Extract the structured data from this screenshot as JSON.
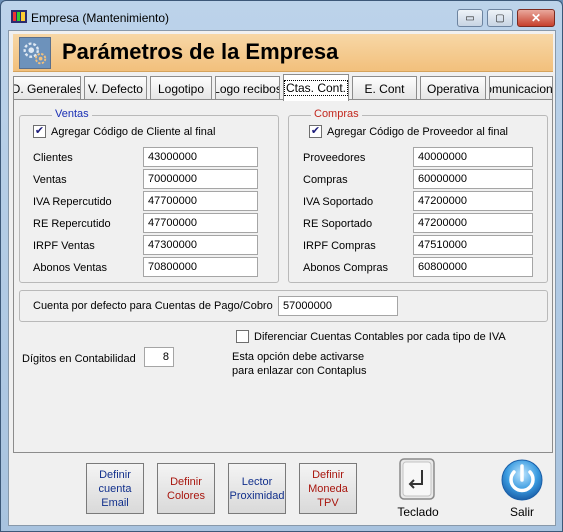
{
  "window": {
    "title": "Empresa  (Mantenimiento)",
    "minimize_glyph": "▭",
    "maximize_glyph": "▢",
    "close_glyph": "✕"
  },
  "banner": {
    "title": "Parámetros de la Empresa"
  },
  "tabs": [
    {
      "label": "D. Generales"
    },
    {
      "label": "V. Defecto"
    },
    {
      "label": "Logotipo"
    },
    {
      "label": "Logo recibos"
    },
    {
      "label": "Ctas. Cont."
    },
    {
      "label": "E. Cont"
    },
    {
      "label": "Operativa"
    },
    {
      "label": "Comunicaciones"
    }
  ],
  "ventas": {
    "legend": "Ventas",
    "checkbox_label": "Agregar Código de Cliente al final",
    "checked": true,
    "fields": [
      {
        "label": "Clientes",
        "value": "43000000"
      },
      {
        "label": "Ventas",
        "value": "70000000"
      },
      {
        "label": "IVA Repercutido",
        "value": "47700000"
      },
      {
        "label": "RE Repercutido",
        "value": "47700000"
      },
      {
        "label": "IRPF Ventas",
        "value": "47300000"
      },
      {
        "label": "Abonos Ventas",
        "value": "70800000"
      }
    ]
  },
  "compras": {
    "legend": "Compras",
    "checkbox_label": "Agregar Código de Proveedor al final",
    "checked": true,
    "fields": [
      {
        "label": "Proveedores",
        "value": "40000000"
      },
      {
        "label": "Compras",
        "value": "60000000"
      },
      {
        "label": "IVA Soportado",
        "value": "47200000"
      },
      {
        "label": "RE Soportado",
        "value": "47200000"
      },
      {
        "label": "IRPF Compras",
        "value": "47510000"
      },
      {
        "label": "Abonos Compras",
        "value": "60800000"
      }
    ]
  },
  "pago_cobro": {
    "label": "Cuenta por defecto para Cuentas de Pago/Cobro",
    "value": "57000000"
  },
  "iva": {
    "checkbox_label": "Diferenciar Cuentas Contables por cada tipo de IVA",
    "checked": false
  },
  "digitos": {
    "label": "Dígitos en Contabilidad",
    "value": "8"
  },
  "note": {
    "line1": "Esta opción debe activarse",
    "line2": "para enlazar con Contaplus"
  },
  "footer": {
    "email_button": "Definir cuenta Email",
    "colores_button": "Definir Colores",
    "lector_button": "Lector Proximidad",
    "moneda_button": "Definir Moneda TPV",
    "teclado_label": "Teclado",
    "salir_label": "Salir"
  },
  "colors": {
    "banner": "#f2c07c",
    "blue_text": "#12308c",
    "red_text": "#a8160e"
  },
  "icons": {
    "app": "app-icon",
    "banner": "settings-gears-icon",
    "teclado": "keyboard-enter-icon",
    "salir": "power-icon"
  }
}
